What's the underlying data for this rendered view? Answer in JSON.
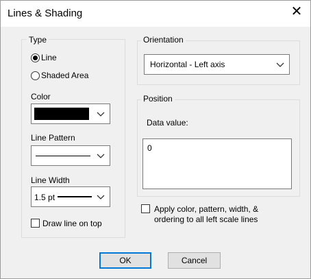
{
  "dialog": {
    "title": "Lines & Shading",
    "close_glyph": "✕"
  },
  "type_group": {
    "label": "Type",
    "options": [
      {
        "label": "Line",
        "selected": true
      },
      {
        "label": "Shaded Area",
        "selected": false
      }
    ]
  },
  "color": {
    "label": "Color",
    "value": "#000000"
  },
  "line_pattern": {
    "label": "Line Pattern",
    "value": "solid"
  },
  "line_width": {
    "label": "Line Width",
    "value": "1.5 pt"
  },
  "draw_on_top": {
    "label": "Draw line on top",
    "checked": false
  },
  "orientation": {
    "label": "Orientation",
    "value": "Horizontal - Left axis"
  },
  "position": {
    "label": "Position",
    "data_value_label": "Data value:",
    "data_value": "0"
  },
  "apply_all": {
    "label_line1": "Apply color, pattern, width, &",
    "label_line2": "ordering to all left scale lines",
    "checked": false
  },
  "buttons": {
    "ok": "OK",
    "cancel": "Cancel"
  }
}
